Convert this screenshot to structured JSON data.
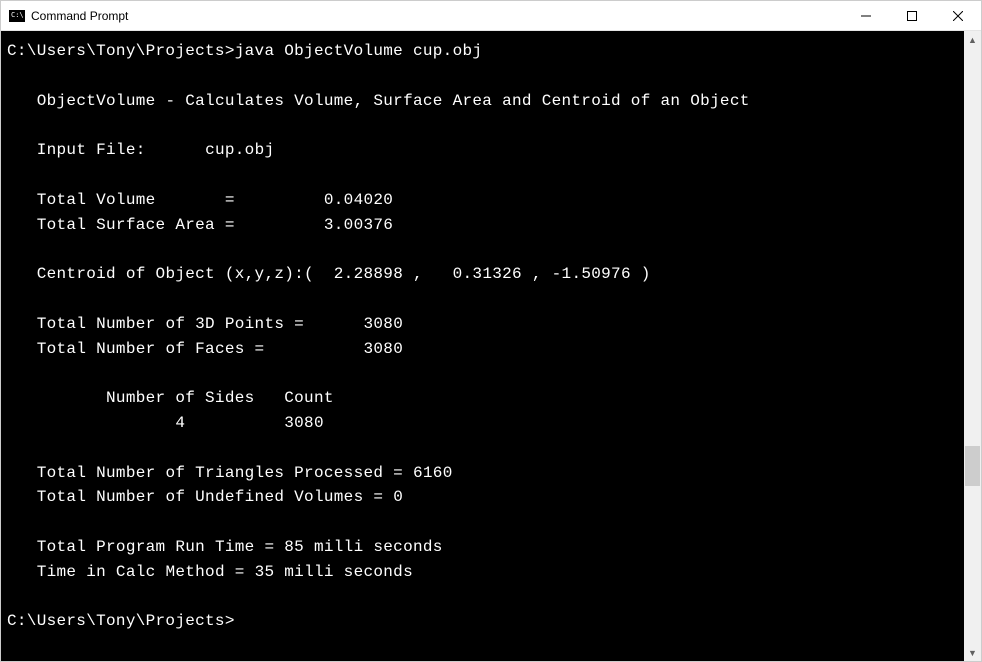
{
  "window": {
    "title": "Command Prompt"
  },
  "console": {
    "prompt_path": "C:\\Users\\Tony\\Projects>",
    "command": "java ObjectVolume cup.obj",
    "output": {
      "app_desc": "ObjectVolume - Calculates Volume, Surface Area and Centroid of an Object",
      "input_file_label": "Input File:",
      "input_file_value": "cup.obj",
      "total_volume_label": "Total Volume       =",
      "total_volume_value": "0.04020",
      "total_surface_label": "Total Surface Area =",
      "total_surface_value": "3.00376",
      "centroid_label": "Centroid of Object (x,y,z):(",
      "centroid_x": "2.28898",
      "centroid_y": "0.31326",
      "centroid_z": "-1.50976",
      "centroid_close": ")",
      "points_label": "Total Number of 3D Points =",
      "points_value": "3080",
      "faces_label": "Total Number of Faces =",
      "faces_value": "3080",
      "sides_header": "Number of Sides   Count",
      "sides_n": "4",
      "sides_count": "3080",
      "triangles_label": "Total Number of Triangles Processed =",
      "triangles_value": "6160",
      "undef_label": "Total Number of Undefined Volumes =",
      "undef_value": "0",
      "runtime_label": "Total Program Run Time =",
      "runtime_value": "85 milli seconds",
      "calctime_label": "Time in Calc Method =",
      "calctime_value": "35 milli seconds"
    },
    "prompt2": "C:\\Users\\Tony\\Projects>"
  }
}
